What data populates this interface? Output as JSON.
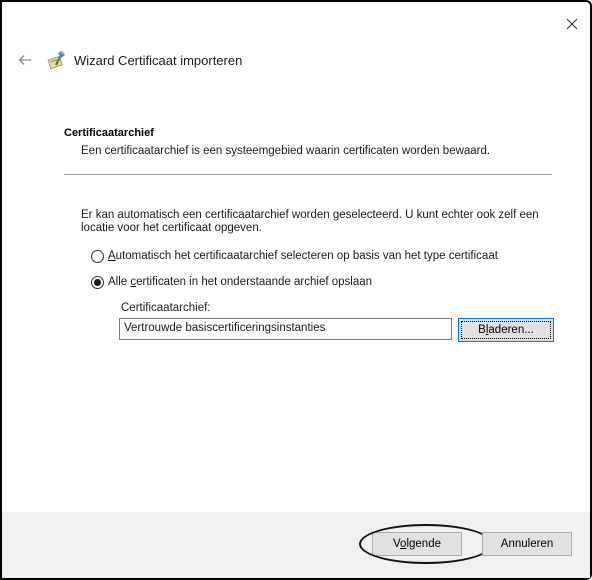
{
  "window": {
    "title": "Wizard Certificaat importeren",
    "close_icon": "close-icon",
    "back_icon": "back-arrow-icon",
    "wizard_icon": "certificate-wizard-icon"
  },
  "header": {
    "title": "Certificaatarchief",
    "description": "Een certificaatarchief is een systeemgebied waarin certificaten worden bewaard."
  },
  "body": {
    "intro": "Er kan automatisch een certificaatarchief worden geselecteerd. U kunt echter ook zelf een locatie voor het certificaat opgeven.",
    "options": [
      {
        "pre": "",
        "accel": "A",
        "post": "utomatisch het certificaatarchief selecteren op basis van het type certificaat",
        "checked": false
      },
      {
        "pre": "Alle ",
        "accel": "c",
        "post": "ertificaten in het onderstaande archief opslaan",
        "checked": true
      }
    ],
    "store_label": "Certificaatarchief:",
    "store_value": "Vertrouwde basiscertificeringsinstanties",
    "browse": {
      "pre": "B",
      "accel": "l",
      "post": "aderen..."
    }
  },
  "footer": {
    "next": {
      "pre": "V",
      "accel": "o",
      "post": "lgende"
    },
    "cancel": "Annuleren"
  },
  "colors": {
    "footer_bg": "#f0f0f0",
    "focus_border": "#0078d7",
    "annotation": "#111111"
  }
}
